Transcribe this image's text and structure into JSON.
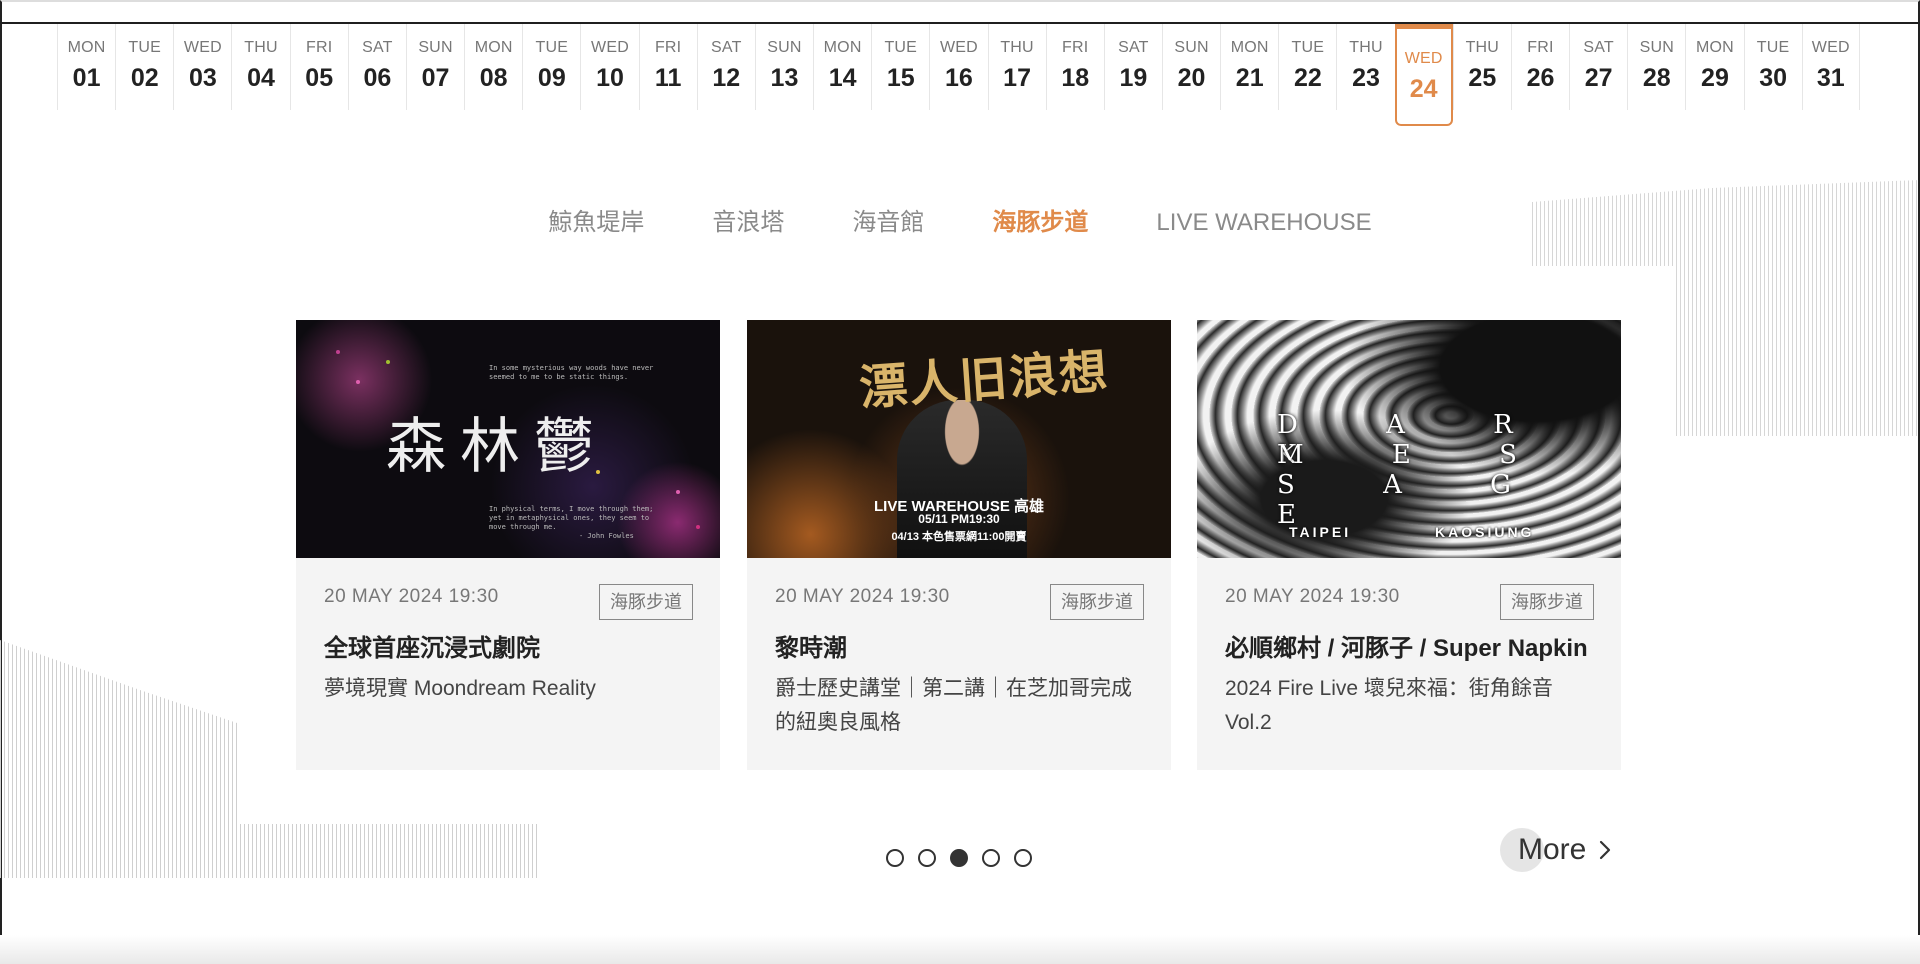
{
  "date_strip": {
    "days": [
      {
        "name": "MON",
        "num": "01"
      },
      {
        "name": "TUE",
        "num": "02"
      },
      {
        "name": "WED",
        "num": "03"
      },
      {
        "name": "THU",
        "num": "04"
      },
      {
        "name": "FRI",
        "num": "05"
      },
      {
        "name": "SAT",
        "num": "06"
      },
      {
        "name": "SUN",
        "num": "07"
      },
      {
        "name": "MON",
        "num": "08"
      },
      {
        "name": "TUE",
        "num": "09"
      },
      {
        "name": "WED",
        "num": "10"
      },
      {
        "name": "FRI",
        "num": "11"
      },
      {
        "name": "SAT",
        "num": "12"
      },
      {
        "name": "SUN",
        "num": "13"
      },
      {
        "name": "MON",
        "num": "14"
      },
      {
        "name": "TUE",
        "num": "15"
      },
      {
        "name": "WED",
        "num": "16"
      },
      {
        "name": "THU",
        "num": "17"
      },
      {
        "name": "FRI",
        "num": "18"
      },
      {
        "name": "SAT",
        "num": "19"
      },
      {
        "name": "SUN",
        "num": "20"
      },
      {
        "name": "MON",
        "num": "21"
      },
      {
        "name": "TUE",
        "num": "22"
      },
      {
        "name": "THU",
        "num": "23"
      },
      {
        "name": "WED",
        "num": "24"
      },
      {
        "name": "THU",
        "num": "25"
      },
      {
        "name": "FRI",
        "num": "26"
      },
      {
        "name": "SAT",
        "num": "27"
      },
      {
        "name": "SUN",
        "num": "28"
      },
      {
        "name": "MON",
        "num": "29"
      },
      {
        "name": "TUE",
        "num": "30"
      },
      {
        "name": "WED",
        "num": "31"
      }
    ],
    "active_index": 23,
    "accent_color": "#e08a4a"
  },
  "venues": {
    "tabs": [
      "鯨魚堤岸",
      "音浪塔",
      "海音館",
      "海豚步道",
      "LIVE WAREHOUSE"
    ],
    "active_index": 3
  },
  "cards": [
    {
      "date": "20 MAY 2024 19:30",
      "tag": "海豚步道",
      "title": "全球首座沉浸式劇院",
      "subtitle": "夢境現實 Moondream Reality",
      "image": {
        "big_text": "森林鬱",
        "line1": "In some mysterious way woods have never",
        "line2": "seemed to me to be static things.",
        "line3": "In physical terms, I move through them;",
        "line4": "yet in metaphysical ones, they seem to",
        "line5": "move through me.",
        "credit": "- John Fowles"
      }
    },
    {
      "date": "20 MAY 2024 19:30",
      "tag": "海豚步道",
      "title": "黎時潮",
      "subtitle": "爵士歷史講堂｜第二講｜在芝加哥完成的紐奧良風格",
      "image": {
        "title": "漂人旧浪想",
        "venue": "LIVE WAREHOUSE 高雄",
        "time": "05/11 PM19:30",
        "sale": "04/13 本色售票網11:00開賣"
      }
    },
    {
      "date": "20 MAY 2024 19:30",
      "tag": "海豚步道",
      "title": "必順鄉村 / 河豚子 / Super Napkin",
      "subtitle": "2024 Fire Live 壞兒來福：街角餘音 Vol.2",
      "image": {
        "line1": "D A R K",
        "line2": "M E S S A G E",
        "city_left": "TAIPEI",
        "city_right": "KAOSIUNG"
      }
    }
  ],
  "pager": {
    "count": 5,
    "active_index": 2
  },
  "more": {
    "label": "More"
  }
}
